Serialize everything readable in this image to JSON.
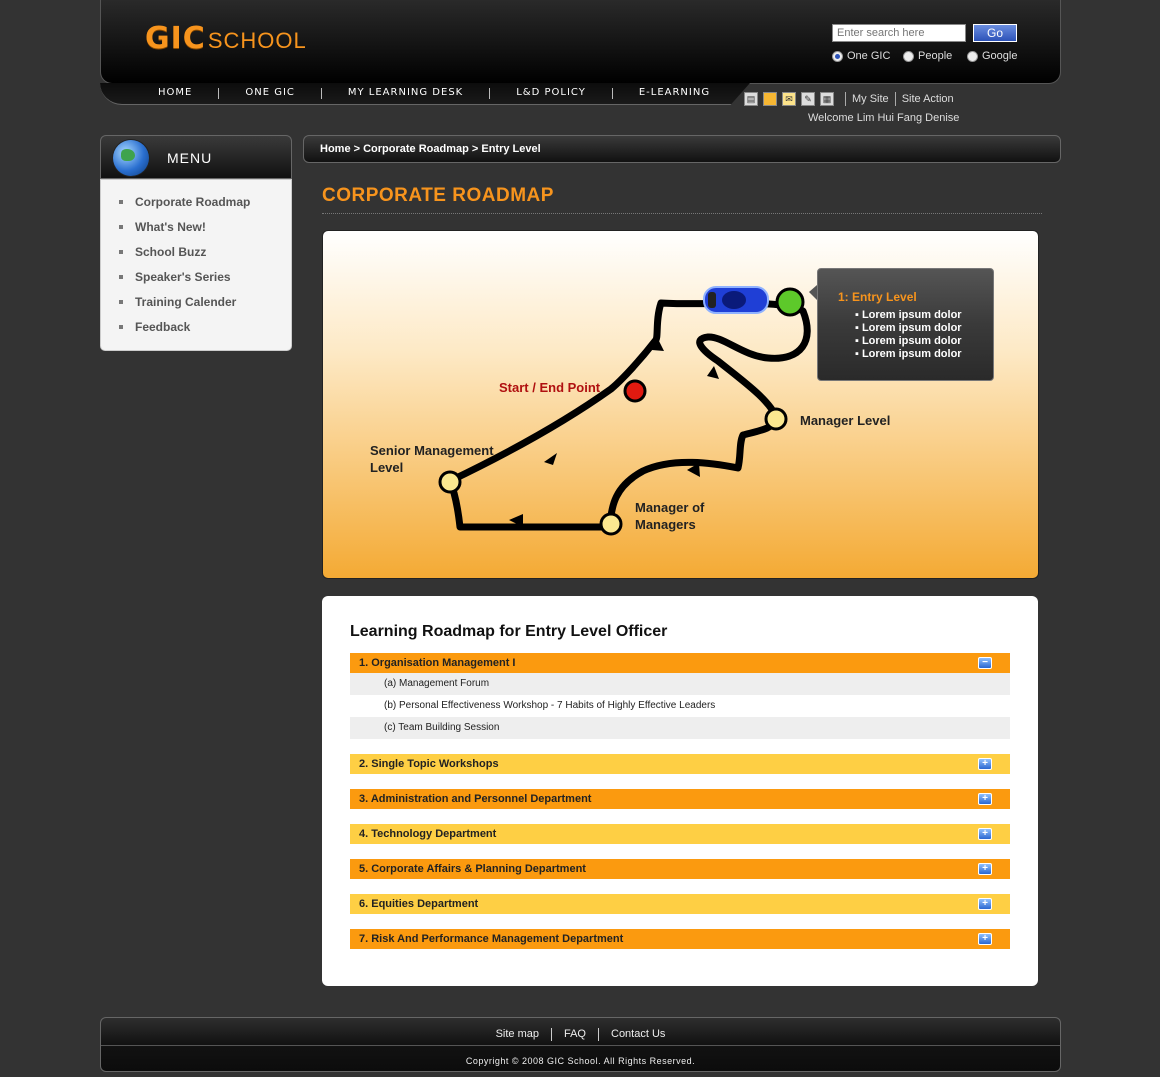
{
  "header": {
    "logo_gic": "GIC",
    "logo_school": "SCHOOL",
    "search_placeholder": "Enter search here",
    "search_button": "Go",
    "search_scopes": [
      "One GIC",
      "People",
      "Google"
    ],
    "selected_scope": "One GIC"
  },
  "nav": {
    "items": [
      "HOME",
      "ONE GIC",
      "MY LEARNING DESK",
      "L&D POLICY",
      "E-LEARNING"
    ]
  },
  "tools": {
    "icons": [
      "print-icon",
      "bookmark-icon",
      "email-icon",
      "edit-icon",
      "calendar-icon"
    ],
    "links": [
      "My Site",
      "Site Action"
    ],
    "welcome": "Welcome Lim Hui Fang Denise"
  },
  "sidebar": {
    "title": "MENU",
    "items": [
      "Corporate Roadmap",
      "What's New!",
      "School Buzz",
      "Speaker's Series",
      "Training Calender",
      "Feedback"
    ]
  },
  "breadcrumb": "Home > Corporate Roadmap > Entry Level",
  "page_title": "CORPORATE ROADMAP",
  "roadmap": {
    "start_label": "Start / End Point",
    "senior_label_1": "Senior Management",
    "senior_label_2": "Level",
    "manager_label": "Manager Level",
    "mom_label_1": "Manager of",
    "mom_label_2": "Managers",
    "popup_title": "1:  Entry Level",
    "popup_items": [
      "▪ Lorem ipsum dolor",
      "▪ Lorem ipsum dolor",
      "▪ Lorem ipsum dolor",
      "▪ Lorem ipsum dolor"
    ]
  },
  "learning": {
    "title": "Learning Roadmap for Entry Level Officer",
    "sections": [
      "1. Organisation Management I",
      "2. Single Topic Workshops",
      "3. Administration and Personnel Department",
      "4. Technology Department",
      "5. Corporate Affairs & Planning Department",
      "6. Equities Department",
      "7. Risk And Performance Management Department"
    ],
    "sub_items": [
      "(a) Management Forum",
      "(b) Personal Effectiveness Workshop - 7 Habits of Highly Effective Leaders",
      "(c) Team Building Session"
    ],
    "collapse_symbol": "−",
    "expand_symbol": "+"
  },
  "footer": {
    "links": [
      "Site map",
      "FAQ",
      "Contact Us"
    ],
    "copyright": "Copyright © 2008 GIC School. All Rights Reserved."
  },
  "colors": {
    "accent": "#f7941d",
    "row_dark": "#fb9a0f",
    "row_light": "#fecf44",
    "background": "#333333"
  }
}
